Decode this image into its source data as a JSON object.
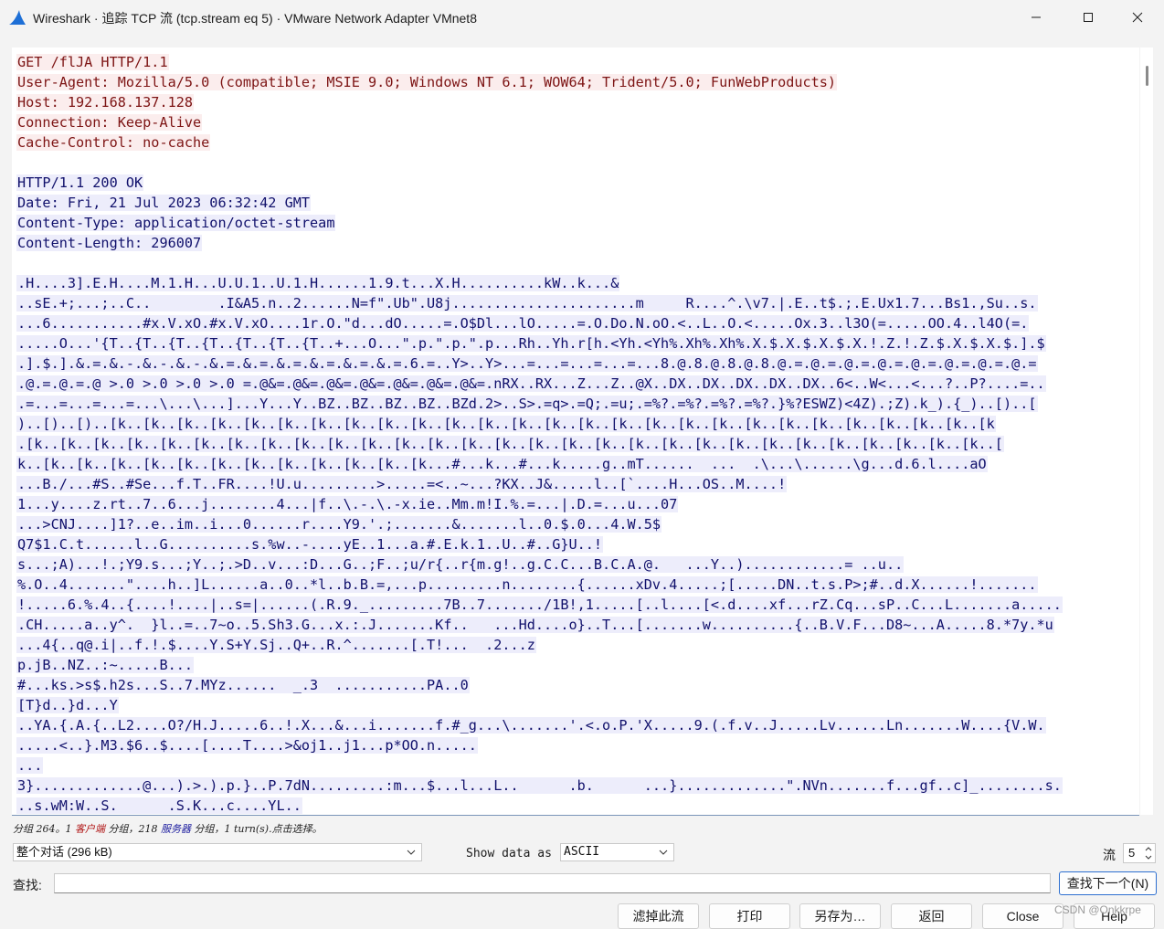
{
  "window": {
    "title": "Wireshark · 追踪 TCP 流 (tcp.stream eq 5) · VMware Network Adapter VMnet8",
    "icon": "wireshark-fin-icon",
    "controls": [
      "minimize-icon",
      "maximize-icon",
      "close-icon"
    ]
  },
  "colors": {
    "client_bg": "#fbeded",
    "client_fg": "#7d1414",
    "server_bg": "#ededfb",
    "server_fg": "#10106b"
  },
  "stream": {
    "client_lines": [
      "GET /flJA HTTP/1.1",
      "User-Agent: Mozilla/5.0 (compatible; MSIE 9.0; Windows NT 6.1; WOW64; Trident/5.0; FunWebProducts)",
      "Host: 192.168.137.128",
      "Connection: Keep-Alive",
      "Cache-Control: no-cache"
    ],
    "server_header_lines": [
      "HTTP/1.1 200 OK",
      "Date: Fri, 21 Jul 2023 06:32:42 GMT",
      "Content-Type: application/octet-stream",
      "Content-Length: 296007"
    ],
    "server_body_lines": [
      ".H....3].E.H....M.1.H...U.U.1..U.1.H......1.9.t...X.H..........kW..k...&",
      "..sE.+;...;..C..        .I&A5.n..2......N=f\".Ub\".U8j......................m     R....^.\\v7.|.E..t$.;.E.Ux1.7...Bs1.,Su..s.",
      "...6...........#x.V.xO.#x.V.xO....1r.O.\"d...dO.....=.O$Dl...lO.....=.O.Do.N.oO.<..L..O.<.....Ox.3..l3O(=.....OO.4..l4O(=.",
      ".....O...'{T..{T..{T..{T..{T..{T..{T..+...O...\".p.\".p.\".p...Rh..Yh.r[h.<Yh.<Yh%.Xh%.Xh%.X.$.X.$.X.$.X.!.Z.!.Z.$.X.$.X.$.].$",
      ".].$.].&.=.&.-.&.-.&.-.&.=.&.=.&.=.&.=.&.=.&.=.6.=..Y>..Y>...=...=...=...=...8.@.8.@.8.@.8.@.=.@.=.@.=.@.=.@.=.@.=.@.=.@.=",
      ".@.=.@.=.@ >.0 >.0 >.0 >.0 =.@&=.@&=.@&=.@&=.@&=.@&=.@&=.nRX..RX...Z...Z..@X..DX..DX..DX..DX..DX..6<..W<...<...?..P?....=..",
      ".=...=...=...=...\\...\\...]...Y...Y..BZ..BZ..BZ..BZ..BZd.2>..S>.=q>.=Q;.=u;.=%?.=%?.=%?.=%?.}%?ESWZ)<4Z).;Z).k_).{_)..[)..[",
      ")..[)..[)..[k..[k..[k..[k..[k..[k..[k..[k..[k..[k..[k..[k..[k..[k..[k..[k..[k..[k..[k..[k..[k..[k..[k..[k..[k..[k..[k",
      ".[k..[k..[k..[k..[k..[k..[k..[k..[k..[k..[k..[k..[k..[k..[k..[k..[k..[k..[k..[k..[k..[k..[k..[k..[k..[k..[k..[k..[k..[",
      "k..[k..[k..[k..[k..[k..[k..[k..[k..[k..[k..[k..[k...#...k...#...k.....g..mT......  ...  .\\...\\......\\g...d.6.l....aO",
      "...B./...#S..#Se...f.T..FR....!U.u.........>.....=<..~...?KX..J&.....l..[`....H...OS..M....!",
      "1...y....z.rt..7..6...j........4...|f..\\.-.\\.-x.ie..Mm.m!I.%.=...|.D.=...u...07",
      "...>CNJ....]1?..e..im..i...0......r....Y9.'.;.......&.......l..0.$.0...4.W.5$",
      "Q7$1.C.t......l..G..........s.%w..-....yE..1...a.#.E.k.1..U..#..G}U..!",
      "s...;A)...!.;Y9.s...;Y..;.>D..v...:D...G..;F..;u/r{..r{m.g!..g.C.C...B.C.A.@.   ...Y..)............= ..u..",
      "%.O..4.......\"....h..]L......a..0..*l..b.B.=,...p.........n........{......xDv.4.....;[.....DN..t.s.P>;#..d.X......!.......",
      "!.....6.%.4..{....!....|..s=|......(.R.9._.........7B..7......./1B!,1.....[..l....[<.d....xf...rZ.Cq...sP..C...L.......a.....",
      ".CH.....a..y^.  }l..=..7~o..5.Sh3.G...x.:.J.......Kf..   ...Hd....o}..T...[.......w..........{..B.V.F...D8~...A.....8.*7y.*u",
      "...4{..q@.i|..f.!.$....Y.S+Y.Sj..Q+..R.^.......[.T!...  .2...z",
      "p.jB..NZ..:~.....B...",
      "#...ks.>s$.h2s...S..7.MYz......  _.3  ...........PA..0",
      "[T}d..}d...Y",
      "..YA.{.A.{..L2....O?/H.J.....6..!.X...&...i.......f.#_g...\\.......'.<.o.P.'X.....9.(.f.v..J.....Lv......Ln.......W....{V.W.",
      ".....<..}.M3.$6..$....[....T....>&oj1..j1...p*OO.n.....",
      "...",
      "3}.............@...).>.).p.}..P.7dN.........:m...$...l...L..      .b.      ...}.............\".NVn.......f...gf..c]_........s.",
      "..s.wM:W..S.      .S.K...c....YL.."
    ]
  },
  "status": {
    "prefix": "分组 264。1 ",
    "client_word": "客户端",
    "middle": " 分组，218 ",
    "server_word": "服务器",
    "suffix": " 分组，1 turn(s).点击选择。"
  },
  "controls": {
    "conversation_select": "整个对话 (296 kB)",
    "show_data_label": "Show data as",
    "show_data_value": "ASCII",
    "stream_label": "流",
    "stream_value": "5",
    "find_label": "查找:",
    "find_value": "",
    "find_next_button": "查找下一个(N)"
  },
  "buttons": {
    "filter_out": "滤掉此流",
    "print": "打印",
    "save_as": "另存为…",
    "back": "返回",
    "close": "Close",
    "help": "Help"
  },
  "watermark": "CSDN @Onkkrpe"
}
